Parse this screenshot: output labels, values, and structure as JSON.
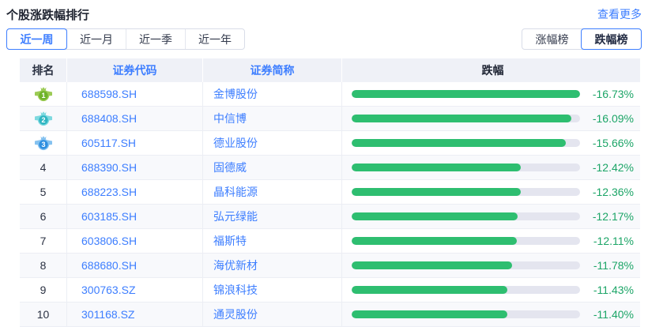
{
  "header": {
    "title": "个股涨跌幅排行",
    "more_link": "查看更多"
  },
  "period_tabs": [
    {
      "name": "period-tab-last-week",
      "label": "近一周",
      "selected": true
    },
    {
      "name": "period-tab-last-month",
      "label": "近一月",
      "selected": false
    },
    {
      "name": "period-tab-last-quarter",
      "label": "近一季",
      "selected": false
    },
    {
      "name": "period-tab-last-year",
      "label": "近一年",
      "selected": false
    }
  ],
  "board_tabs": [
    {
      "name": "board-tab-gainers",
      "label": "涨幅榜",
      "selected": false
    },
    {
      "name": "board-tab-losers",
      "label": "跌幅榜",
      "selected": true
    }
  ],
  "colors": {
    "accent_blue": "#3d7eff",
    "bar_green": "#2ebe70",
    "bar_track": "#e4e5ef",
    "percent_green": "#1ca567"
  },
  "table": {
    "headers": [
      "排名",
      "证券代码",
      "证券简称",
      "跌幅"
    ],
    "max_value": 16.73,
    "rows": [
      {
        "rank": "1",
        "medal": {
          "body": "#6fb32a",
          "wing": "#9ccb55"
        },
        "code": "688598.SH",
        "name": "金博股份",
        "change": "-16.73%",
        "value": 16.73
      },
      {
        "rank": "2",
        "medal": {
          "body": "#2fb5c2",
          "wing": "#7ed9df"
        },
        "code": "688408.SH",
        "name": "中信博",
        "change": "-16.09%",
        "value": 16.09
      },
      {
        "rank": "3",
        "medal": {
          "body": "#2e8fe0",
          "wing": "#85c2f0"
        },
        "code": "605117.SH",
        "name": "德业股份",
        "change": "-15.66%",
        "value": 15.66
      },
      {
        "rank": "4",
        "medal": null,
        "code": "688390.SH",
        "name": "固德威",
        "change": "-12.42%",
        "value": 12.42
      },
      {
        "rank": "5",
        "medal": null,
        "code": "688223.SH",
        "name": "晶科能源",
        "change": "-12.36%",
        "value": 12.36
      },
      {
        "rank": "6",
        "medal": null,
        "code": "603185.SH",
        "name": "弘元绿能",
        "change": "-12.17%",
        "value": 12.17
      },
      {
        "rank": "7",
        "medal": null,
        "code": "603806.SH",
        "name": "福斯特",
        "change": "-12.11%",
        "value": 12.11
      },
      {
        "rank": "8",
        "medal": null,
        "code": "688680.SH",
        "name": "海优新材",
        "change": "-11.78%",
        "value": 11.78
      },
      {
        "rank": "9",
        "medal": null,
        "code": "300763.SZ",
        "name": "锦浪科技",
        "change": "-11.43%",
        "value": 11.43
      },
      {
        "rank": "10",
        "medal": null,
        "code": "301168.SZ",
        "name": "通灵股份",
        "change": "-11.40%",
        "value": 11.4
      }
    ]
  }
}
